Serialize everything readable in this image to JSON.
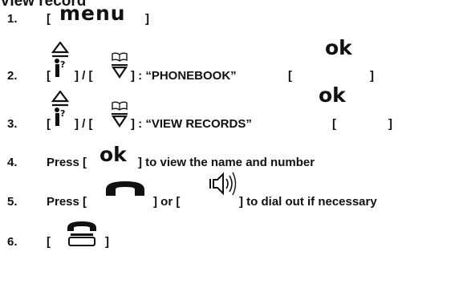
{
  "title": "View record",
  "steps": [
    {
      "num": "1.",
      "open": "[",
      "key": "menu",
      "close": "]"
    },
    {
      "num": "2.",
      "open1": "[",
      "mid": "] / [",
      "after": "] : “PHONEBOOK”",
      "open2": "[",
      "close2": "]",
      "confirm_key": "ok"
    },
    {
      "num": "3.",
      "open1": "[",
      "mid": "] / [",
      "after": "] : “VIEW RECORDS”",
      "open2": "[",
      "close2": "]",
      "confirm_key": "ok"
    },
    {
      "num": "4.",
      "pre": "Press [",
      "key": "ok",
      "post": "] to view the name and number"
    },
    {
      "num": "5.",
      "pre": "Press [",
      "between": "] or [",
      "post": "] to dial out if necessary"
    },
    {
      "num": "6.",
      "open": "[",
      "close": "]"
    }
  ],
  "icons": {
    "up": "up-arrow-person-icon",
    "down": "phonebook-down-arrow-icon",
    "talk": "handset-talk-icon",
    "speaker": "speakerphone-icon",
    "end": "end-call-phone-icon"
  },
  "colors": {
    "text": "#111111",
    "background": "#ffffff"
  }
}
